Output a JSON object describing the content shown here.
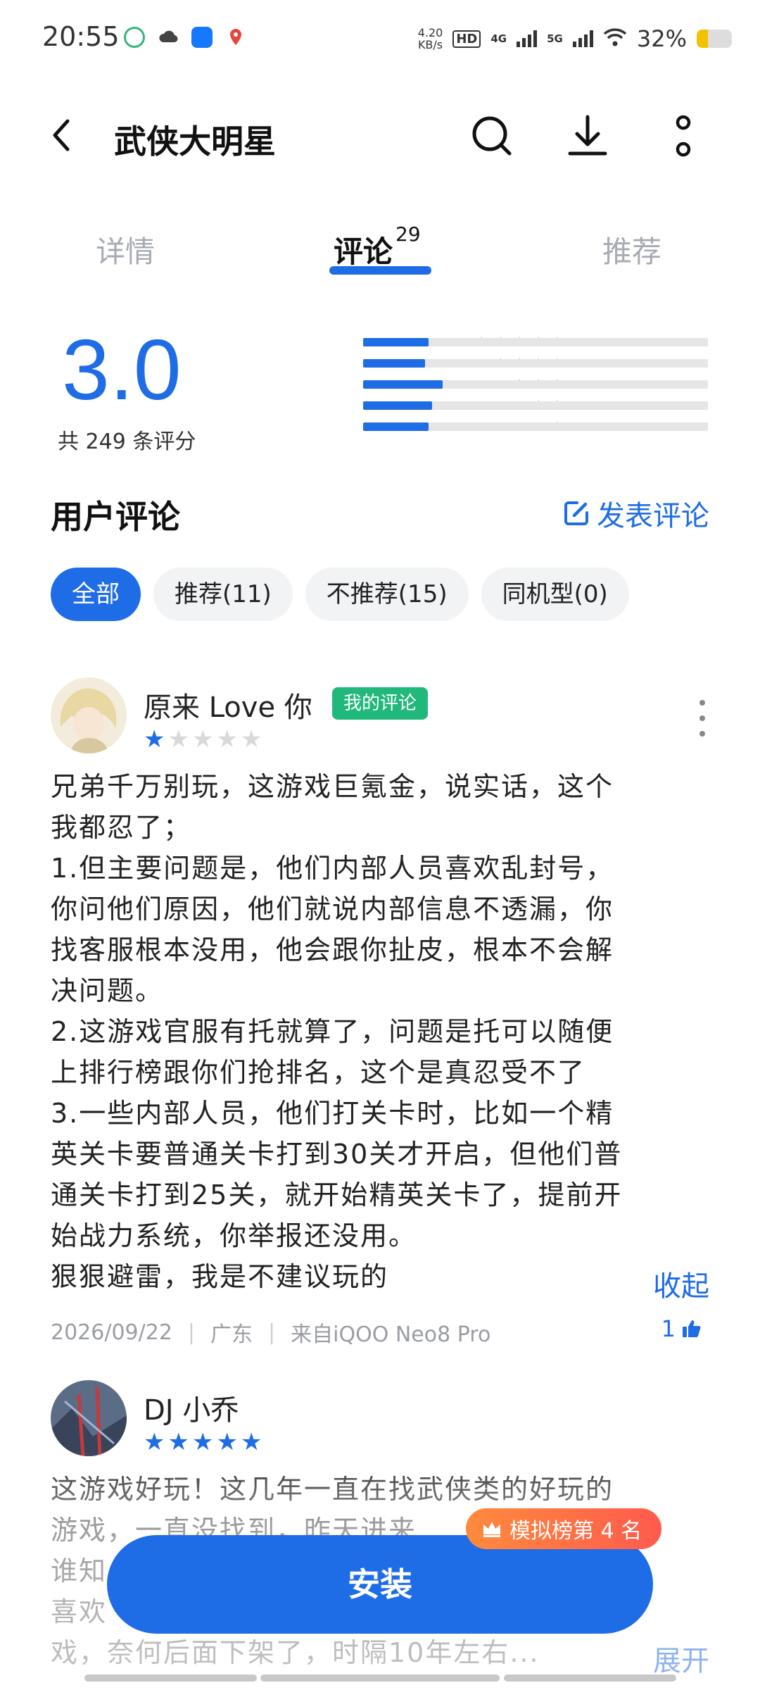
{
  "status_bar": {
    "time": "20:55",
    "net_speed_value": "4.20",
    "net_speed_unit": "KB/s",
    "hd_label": "HD",
    "sim1": "4G",
    "sim2": "5G",
    "battery_text": "32%",
    "battery_level": 0.32
  },
  "header": {
    "title": "武侠大明星"
  },
  "tabs": {
    "details": "详情",
    "reviews": "评论",
    "reviews_count": "29",
    "recommend": "推荐"
  },
  "rating": {
    "score": "3.0",
    "count_text": "共 249 条评分",
    "distribution": [
      {
        "stars": 5,
        "fraction": 0.19
      },
      {
        "stars": 4,
        "fraction": 0.18
      },
      {
        "stars": 3,
        "fraction": 0.23
      },
      {
        "stars": 2,
        "fraction": 0.2
      },
      {
        "stars": 1,
        "fraction": 0.19
      }
    ]
  },
  "section": {
    "title": "用户评论",
    "write_review": "发表评论"
  },
  "filters": [
    "全部",
    "推荐(11)",
    "不推荐(15)",
    "同机型(0)"
  ],
  "review1": {
    "name": "原来 Love 你",
    "badge": "我的评论",
    "stars": 1,
    "lines": [
      "兄弟千万别玩，这游戏巨氪金，说实话，这个",
      "我都忍了；",
      "1.但主要问题是，他们内部人员喜欢乱封号，",
      "你问他们原因，他们就说内部信息不透漏，你",
      "找客服根本没用，他会跟你扯皮，根本不会解",
      "决问题。",
      "2.这游戏官服有托就算了，问题是托可以随便",
      "上排行榜跟你们抢排名，这个是真忍受不了",
      "3.一些内部人员，他们打关卡时，比如一个精",
      "英关卡要普通关卡打到30关才开启，但他们普",
      "通关卡打到25关，就开始精英关卡了，提前开",
      "始战力系统，你举报还没用。",
      "狠狠避雷，我是不建议玩的"
    ],
    "collapse": "收起",
    "date": "2026/09/22",
    "region": "广东",
    "device": "来自iQOO Neo8 Pro",
    "likes": "1"
  },
  "review2": {
    "name": "DJ 小乔",
    "stars": 5,
    "lines": [
      "这游戏好玩！这几年一直在找武侠类的好玩的",
      "游戏，一直没找到，昨天进来　　　　　　，",
      "谁知　　　　　　　　　　　　　　　　　经",
      "喜欢　　　　　　　　　　　　　　　　　游",
      "戏，奈何后面下架了，时隔10年左右..."
    ],
    "expand": "展开"
  },
  "rank_badge": "模拟榜第 4 名",
  "install_button": "安装",
  "colors": {
    "accent": "#1e6ce6",
    "badge_green": "#21b87b",
    "rank_orange": "#ff6a45"
  }
}
